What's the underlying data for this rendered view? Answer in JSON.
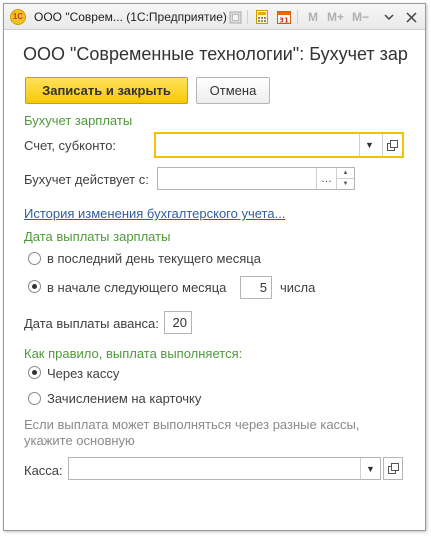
{
  "window": {
    "title": "ООО \"Соврем... (1С:Предприятие)",
    "logo_text": "1С",
    "toolbar": {
      "m_label": "M",
      "m_plus_label": "M+",
      "m_minus_label": "M−",
      "calendar_day": "31"
    }
  },
  "form": {
    "title": "ООО \"Современные технологии\": Бухучет зарплаты",
    "save_close_label": "Записать и закрыть",
    "cancel_label": "Отмена"
  },
  "accounting": {
    "section_label": "Бухучет зарплаты",
    "account_label": "Счет, субконто:",
    "account_value": "",
    "effective_label": "Бухучет действует с:",
    "effective_value": "",
    "history_link": "История изменения бухгалтерского учета..."
  },
  "payment_date": {
    "section_label": "Дата выплаты зарплаты",
    "option_last_day": "в последний день текущего месяца",
    "option_next_month": "в начале следующего месяца",
    "selected": "next_month",
    "day_value": "5",
    "day_suffix": "числа",
    "advance_label": "Дата выплаты аванса:",
    "advance_value": "20"
  },
  "payment_method": {
    "section_label": "Как правило, выплата выполняется:",
    "option_cash": "Через кассу",
    "option_card": "Зачислением на карточку",
    "selected": "cash",
    "hint": "Если выплата может выполняться через разные кассы, укажите основную",
    "cashbox_label": "Касса:",
    "cashbox_value": ""
  },
  "colors": {
    "accent_yellow": "#f7c806",
    "section_green": "#4e9a3a",
    "link_blue": "#2f5f9e",
    "hint_gray": "#8a8a8a"
  }
}
